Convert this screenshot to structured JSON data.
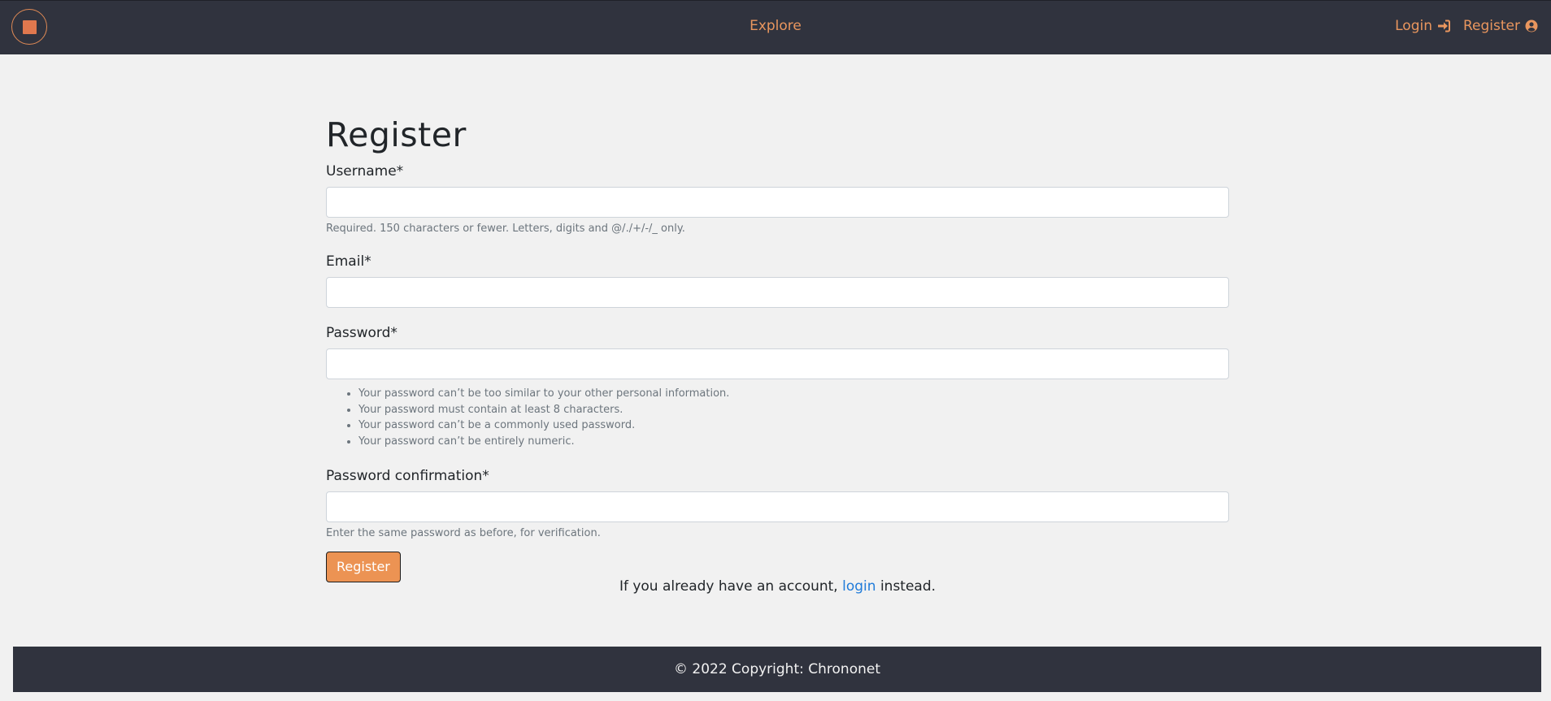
{
  "navbar": {
    "logo_icon": "orange-square-icon",
    "center_link": "Explore",
    "login_label": "Login",
    "login_icon": "sign-in-icon",
    "register_label": "Register",
    "register_icon": "user-circle-icon",
    "accent_color": "#e9965e",
    "background_color": "#30333e"
  },
  "form": {
    "title": "Register",
    "username_label": "Username*",
    "username_value": "",
    "username_help": "Required. 150 characters or fewer. Letters, digits and @/./+/-/_ only.",
    "email_label": "Email*",
    "email_value": "",
    "password_label": "Password*",
    "password_value": "",
    "password_rules": [
      "Your password can’t be too similar to your other personal information.",
      "Your password must contain at least 8 characters.",
      "Your password can’t be a commonly used password.",
      "Your password can’t be entirely numeric."
    ],
    "password_confirmation_label": "Password confirmation*",
    "password_confirmation_value": "",
    "password_confirmation_help": "Enter the same password as before, for verification.",
    "submit_label": "Register",
    "button_color": "#ec9353"
  },
  "account_note": {
    "prefix": "If you already have an account, ",
    "link_text": "login",
    "suffix": " instead."
  },
  "footer": {
    "text": "© 2022 Copyright: Chrononet"
  }
}
